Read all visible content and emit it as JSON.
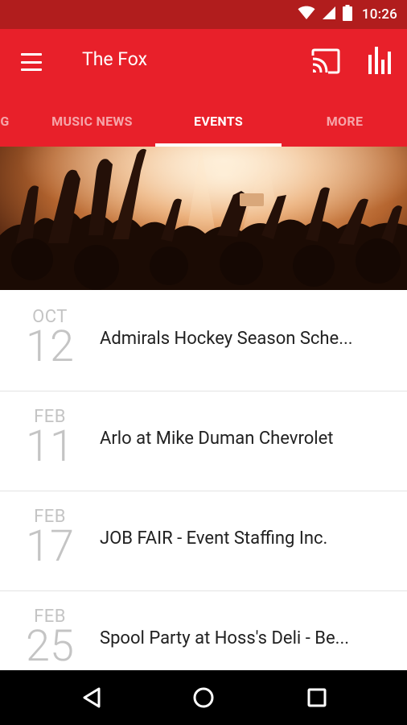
{
  "status_bar": {
    "time": "10:26"
  },
  "app_bar": {
    "title": "The Fox"
  },
  "tabs": [
    {
      "label": "G"
    },
    {
      "label": "MUSIC NEWS"
    },
    {
      "label": "EVENTS"
    },
    {
      "label": "MORE"
    }
  ],
  "active_tab": "EVENTS",
  "events": [
    {
      "month": "OCT",
      "day": "12",
      "title": "Admirals Hockey Season Sche..."
    },
    {
      "month": "FEB",
      "day": "11",
      "title": "Arlo at Mike Duman Chevrolet"
    },
    {
      "month": "FEB",
      "day": "17",
      "title": "JOB FAIR - Event Staffing Inc."
    },
    {
      "month": "FEB",
      "day": "25",
      "title": "Spool Party at Hoss's Deli - Be..."
    }
  ],
  "colors": {
    "status_bar": "#b11d1d",
    "app_bar": "#e8202a",
    "date_text": "#c4c4c4"
  }
}
